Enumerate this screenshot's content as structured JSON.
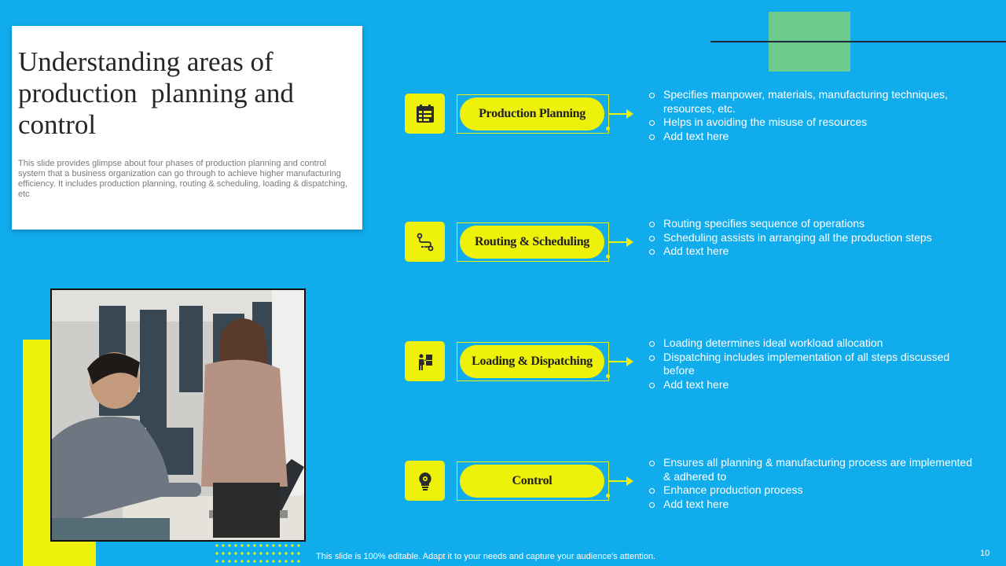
{
  "slide": {
    "title": "Understanding areas of production  planning and control",
    "description": "This slide provides glimpse about four phases of production planning and control system that a business organization can go through to achieve higher manufacturing efficiency. It includes production planning, routing & scheduling, loading & dispatching, etc",
    "footer": "This slide is 100% editable. Adapt it to your needs and capture your audience's attention.",
    "page_number": "10"
  },
  "photo": {
    "icon": "office-meeting-photo"
  },
  "colors": {
    "background": "#10acec",
    "accent_yellow": "#eef10a",
    "accent_green": "#6ccc8e",
    "text_dark": "#262626"
  },
  "phases": [
    {
      "label": "Production Planning",
      "icon": "planning-board-icon",
      "bullets": [
        "Specifies manpower, materials, manufacturing techniques, resources, etc.",
        "Helps in avoiding the misuse of resources",
        "Add text here"
      ]
    },
    {
      "label": "Routing & Scheduling",
      "icon": "route-path-icon",
      "bullets": [
        "Routing specifies sequence of operations",
        "Scheduling assists in arranging all the production steps",
        "Add text here"
      ]
    },
    {
      "label": "Loading & Dispatching",
      "icon": "loading-worker-icon",
      "bullets": [
        "Loading determines ideal workload allocation",
        "Dispatching includes implementation of all steps discussed before",
        "Add text here"
      ]
    },
    {
      "label": "Control",
      "icon": "lightbulb-gear-icon",
      "bullets": [
        "Ensures all planning & manufacturing process are implemented & adhered to",
        "Enhance production process",
        "Add text here"
      ]
    }
  ]
}
